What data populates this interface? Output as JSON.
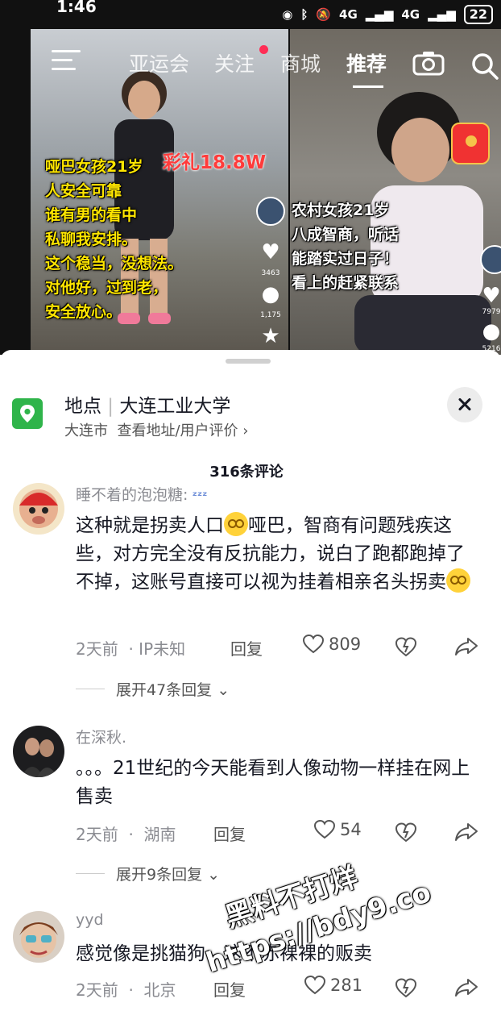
{
  "status_bar": {
    "time": "1:46",
    "network_1": "4G",
    "network_2": "4G",
    "battery": "22"
  },
  "top_nav": {
    "tabs": [
      "亚运会",
      "关注",
      "商城",
      "推荐"
    ],
    "active_tab": "推荐"
  },
  "videos": {
    "left": {
      "caption_lines": [
        "哑巴女孩21岁",
        "人安全可靠",
        "谁有男的看中",
        "私聊我安排。",
        "这个稳当，没想法。",
        "对他好，过到老，",
        "安全放心。"
      ],
      "caili": "彩礼18.8W",
      "likes": "3463",
      "comments": "1,175"
    },
    "right": {
      "caption_lines": [
        "农村女孩21岁",
        "八成智商，听话",
        "能踏实过日子！",
        "看上的赶紧联系"
      ],
      "likes": "7979",
      "comments": "5216"
    }
  },
  "location": {
    "label": "地点",
    "name": "大连工业大学",
    "city": "大连市",
    "link": "查看地址/用户评价 ›"
  },
  "comment_count": "316条评论",
  "comments": [
    {
      "user": "睡不着的泡泡糖:",
      "text_1": "这种就是拐卖人口",
      "text_2": "哑巴，智商有问题残疾这些，对方完全没有反抗能力，说白了跑都跑掉了不掉，这账号直接可以视为挂着相亲名头拐卖",
      "time": "2天前",
      "ip": "IP未知",
      "reply": "回复",
      "likes": "809",
      "expand": "展开47条回复"
    },
    {
      "user": "在深秋.",
      "text": "。。。21世纪的今天能看到人像动物一样挂在网上售卖",
      "time": "2天前",
      "ip": "湖南",
      "reply": "回复",
      "likes": "54",
      "expand": "展开9条回复"
    },
    {
      "user": "yyd",
      "text": "感觉像是挑猫狗，这不赤裸裸的贩卖",
      "time": "2天前",
      "ip": "北京",
      "reply": "回复",
      "likes": "281"
    }
  ],
  "watermark": {
    "line_1": "黑料不打烊",
    "line_2": "https://bdy9.co"
  }
}
